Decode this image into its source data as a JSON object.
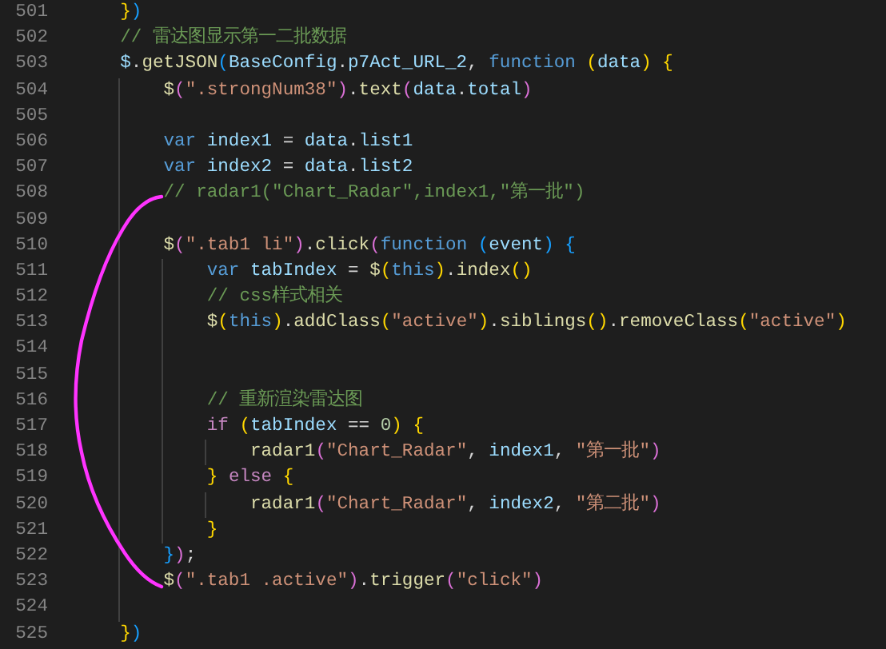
{
  "editor": {
    "lines": [
      {
        "number": "501",
        "tokens": [
          {
            "kind": "br1",
            "text": "    }"
          },
          {
            "kind": "br3",
            "text": ")"
          }
        ]
      },
      {
        "number": "502",
        "tokens": [
          {
            "kind": "cmt",
            "text": "    // 雷达图显示第一二批数据"
          }
        ]
      },
      {
        "number": "503",
        "tokens": [
          {
            "kind": "var",
            "text": "    $"
          },
          {
            "kind": "plain",
            "text": "."
          },
          {
            "kind": "fn",
            "text": "getJSON"
          },
          {
            "kind": "br3",
            "text": "("
          },
          {
            "kind": "var",
            "text": "BaseConfig"
          },
          {
            "kind": "plain",
            "text": "."
          },
          {
            "kind": "var",
            "text": "p7Act_URL_2"
          },
          {
            "kind": "plain",
            "text": ", "
          },
          {
            "kind": "kw",
            "text": "function "
          },
          {
            "kind": "br1",
            "text": "("
          },
          {
            "kind": "var",
            "text": "data"
          },
          {
            "kind": "br1",
            "text": ") {"
          }
        ]
      },
      {
        "number": "504",
        "tokens": [
          {
            "kind": "fn",
            "text": "        $"
          },
          {
            "kind": "br2",
            "text": "("
          },
          {
            "kind": "str",
            "text": "\".strongNum38\""
          },
          {
            "kind": "br2",
            "text": ")"
          },
          {
            "kind": "plain",
            "text": "."
          },
          {
            "kind": "fn",
            "text": "text"
          },
          {
            "kind": "br2",
            "text": "("
          },
          {
            "kind": "var",
            "text": "data"
          },
          {
            "kind": "plain",
            "text": "."
          },
          {
            "kind": "var",
            "text": "total"
          },
          {
            "kind": "br2",
            "text": ")"
          }
        ]
      },
      {
        "number": "505"
      },
      {
        "number": "506",
        "tokens": [
          {
            "kind": "kw",
            "text": "        var "
          },
          {
            "kind": "var",
            "text": "index1"
          },
          {
            "kind": "plain",
            "text": " = "
          },
          {
            "kind": "var",
            "text": "data"
          },
          {
            "kind": "plain",
            "text": "."
          },
          {
            "kind": "var",
            "text": "list1"
          }
        ]
      },
      {
        "number": "507",
        "tokens": [
          {
            "kind": "kw",
            "text": "        var "
          },
          {
            "kind": "var",
            "text": "index2"
          },
          {
            "kind": "plain",
            "text": " = "
          },
          {
            "kind": "var",
            "text": "data"
          },
          {
            "kind": "plain",
            "text": "."
          },
          {
            "kind": "var",
            "text": "list2"
          }
        ]
      },
      {
        "number": "508",
        "tokens": [
          {
            "kind": "cmt",
            "text": "        // radar1(\"Chart_Radar\",index1,\"第一批\")"
          }
        ]
      },
      {
        "number": "509"
      },
      {
        "number": "510",
        "tokens": [
          {
            "kind": "fn",
            "text": "        $"
          },
          {
            "kind": "br2",
            "text": "("
          },
          {
            "kind": "str",
            "text": "\".tab1 li\""
          },
          {
            "kind": "br2",
            "text": ")"
          },
          {
            "kind": "plain",
            "text": "."
          },
          {
            "kind": "fn",
            "text": "click"
          },
          {
            "kind": "br2",
            "text": "("
          },
          {
            "kind": "kw",
            "text": "function "
          },
          {
            "kind": "br3",
            "text": "("
          },
          {
            "kind": "var",
            "text": "event"
          },
          {
            "kind": "br3",
            "text": ") {"
          }
        ]
      },
      {
        "number": "511",
        "tokens": [
          {
            "kind": "kw",
            "text": "            var "
          },
          {
            "kind": "var",
            "text": "tabIndex"
          },
          {
            "kind": "plain",
            "text": " = "
          },
          {
            "kind": "fn",
            "text": "$"
          },
          {
            "kind": "br1",
            "text": "("
          },
          {
            "kind": "kw",
            "text": "this"
          },
          {
            "kind": "br1",
            "text": ")"
          },
          {
            "kind": "plain",
            "text": "."
          },
          {
            "kind": "fn",
            "text": "index"
          },
          {
            "kind": "br1",
            "text": "()"
          }
        ]
      },
      {
        "number": "512",
        "tokens": [
          {
            "kind": "cmt",
            "text": "            // css样式相关"
          }
        ]
      },
      {
        "number": "513",
        "tokens": [
          {
            "kind": "fn",
            "text": "            $"
          },
          {
            "kind": "br1",
            "text": "("
          },
          {
            "kind": "kw",
            "text": "this"
          },
          {
            "kind": "br1",
            "text": ")"
          },
          {
            "kind": "plain",
            "text": "."
          },
          {
            "kind": "fn",
            "text": "addClass"
          },
          {
            "kind": "br1",
            "text": "("
          },
          {
            "kind": "str",
            "text": "\"active\""
          },
          {
            "kind": "br1",
            "text": ")"
          },
          {
            "kind": "plain",
            "text": "."
          },
          {
            "kind": "fn",
            "text": "siblings"
          },
          {
            "kind": "br1",
            "text": "()"
          },
          {
            "kind": "plain",
            "text": "."
          },
          {
            "kind": "fn",
            "text": "removeClass"
          },
          {
            "kind": "br1",
            "text": "("
          },
          {
            "kind": "str",
            "text": "\"active\""
          },
          {
            "kind": "br1",
            "text": ")"
          }
        ]
      },
      {
        "number": "514"
      },
      {
        "number": "515"
      },
      {
        "number": "516",
        "tokens": [
          {
            "kind": "cmt",
            "text": "            // 重新渲染雷达图"
          }
        ]
      },
      {
        "number": "517",
        "tokens": [
          {
            "kind": "ctl",
            "text": "            if "
          },
          {
            "kind": "br1",
            "text": "("
          },
          {
            "kind": "var",
            "text": "tabIndex"
          },
          {
            "kind": "plain",
            "text": " == "
          },
          {
            "kind": "num",
            "text": "0"
          },
          {
            "kind": "br1",
            "text": ") {"
          }
        ]
      },
      {
        "number": "518",
        "tokens": [
          {
            "kind": "fn",
            "text": "                radar1"
          },
          {
            "kind": "br2",
            "text": "("
          },
          {
            "kind": "str",
            "text": "\"Chart_Radar\""
          },
          {
            "kind": "plain",
            "text": ", "
          },
          {
            "kind": "var",
            "text": "index1"
          },
          {
            "kind": "plain",
            "text": ", "
          },
          {
            "kind": "str",
            "text": "\"第一批\""
          },
          {
            "kind": "br2",
            "text": ")"
          }
        ]
      },
      {
        "number": "519",
        "tokens": [
          {
            "kind": "br1",
            "text": "            } "
          },
          {
            "kind": "ctl",
            "text": "else "
          },
          {
            "kind": "br1",
            "text": "{"
          }
        ]
      },
      {
        "number": "520",
        "tokens": [
          {
            "kind": "fn",
            "text": "                radar1"
          },
          {
            "kind": "br2",
            "text": "("
          },
          {
            "kind": "str",
            "text": "\"Chart_Radar\""
          },
          {
            "kind": "plain",
            "text": ", "
          },
          {
            "kind": "var",
            "text": "index2"
          },
          {
            "kind": "plain",
            "text": ", "
          },
          {
            "kind": "str",
            "text": "\"第二批\""
          },
          {
            "kind": "br2",
            "text": ")"
          }
        ]
      },
      {
        "number": "521",
        "tokens": [
          {
            "kind": "br1",
            "text": "            }"
          }
        ]
      },
      {
        "number": "522",
        "tokens": [
          {
            "kind": "br3",
            "text": "        }"
          },
          {
            "kind": "br2",
            "text": ")"
          },
          {
            "kind": "plain",
            "text": ";"
          }
        ]
      },
      {
        "number": "523",
        "tokens": [
          {
            "kind": "fn",
            "text": "        $"
          },
          {
            "kind": "br2",
            "text": "("
          },
          {
            "kind": "str",
            "text": "\".tab1 .active\""
          },
          {
            "kind": "br2",
            "text": ")"
          },
          {
            "kind": "plain",
            "text": "."
          },
          {
            "kind": "fn",
            "text": "trigger"
          },
          {
            "kind": "br2",
            "text": "("
          },
          {
            "kind": "str",
            "text": "\"click\""
          },
          {
            "kind": "br2",
            "text": ")"
          }
        ]
      },
      {
        "number": "524"
      },
      {
        "number": "525",
        "tokens": [
          {
            "kind": "br1",
            "text": "    }"
          },
          {
            "kind": "br3",
            "text": ")"
          }
        ]
      }
    ]
  }
}
